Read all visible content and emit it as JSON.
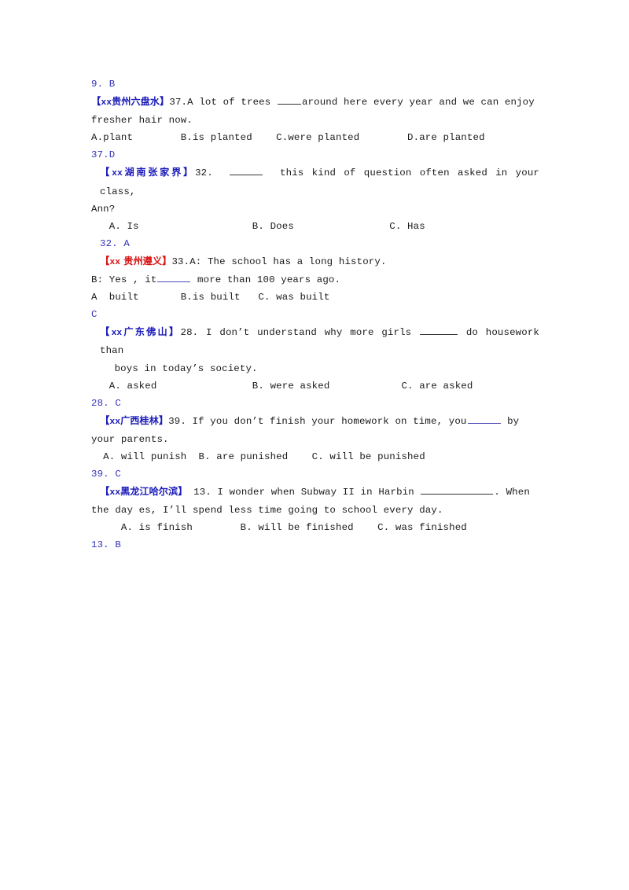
{
  "document": {
    "type": "english-grammar-exercise-answer-key",
    "colors": {
      "answer_blue": "#3333bb",
      "tag_blue": "#1a1aba",
      "tag_red": "#d81111",
      "body_text": "#1a1a1a",
      "page_background": "#ffffff"
    },
    "blocks": [
      {
        "id": "answer-9",
        "kind": "answer",
        "text": "9. B"
      },
      {
        "id": "q37",
        "kind": "question",
        "tag": {
          "bracket_open": "【",
          "xx": "xx",
          "region": "贵州六盘水",
          "bracket_close": "】",
          "color": "blue"
        },
        "number": "37.",
        "stem_part_1": "A lot of trees ",
        "stem_part_2": "around here every year and we can enjoy",
        "stem_line_2": "fresher hair now.",
        "options": "A.plant        B.is planted    C.were planted        D.are planted",
        "answer": "37.D"
      },
      {
        "id": "q32",
        "kind": "question",
        "tag": {
          "bracket_open": "【",
          "xx": "xx",
          "region": "湖南张家界",
          "bracket_close": "】",
          "color": "blue"
        },
        "number": "32.",
        "stem_part_1": "  ",
        "stem_part_2": "  this kind of question often asked in your class,",
        "stem_line_2": "Ann?",
        "options": "   A. Is                   B. Does                C. Has",
        "answer": "32. A"
      },
      {
        "id": "q33",
        "kind": "question",
        "tag": {
          "bracket_open": "【",
          "xx": "xx",
          "region": " 贵州遵义",
          "bracket_close": "】",
          "color": "red"
        },
        "number": "33.",
        "stem_part_1": "A: The school has a long history.",
        "stem_line_2_a": "B: Yes , it",
        "stem_line_2_b": " more than 100 years ago.",
        "options": "A  built       B.is built   C. was built",
        "answer": "C"
      },
      {
        "id": "q28",
        "kind": "question",
        "tag": {
          "bracket_open": "【",
          "xx": "xx",
          "region": "广东佛山",
          "bracket_close": "】",
          "color": "blue"
        },
        "number": "28.",
        "stem_part_1": " I don’t understand why more girls ",
        "stem_part_2": " do housework than",
        "stem_line_2": " boys in today’s society.",
        "options": "   A. asked                B. were asked            C. are asked",
        "answer": "28. C"
      },
      {
        "id": "q39",
        "kind": "question",
        "tag": {
          "bracket_open": "【",
          "xx": "xx",
          "region": "广西桂林",
          "bracket_close": "】",
          "color": "blue"
        },
        "number": "39.",
        "stem_part_1": " If you don’t finish your homework on time, you",
        "stem_part_2": " by",
        "stem_line_2": "your parents.",
        "options": "  A. will punish  B. are punished    C. will be punished",
        "answer": "39. C"
      },
      {
        "id": "q13",
        "kind": "question",
        "tag": {
          "bracket_open": "【",
          "xx": "xx",
          "region": "黑龙江哈尔滨",
          "bracket_close": "】",
          "color": "blue"
        },
        "number": " 13.",
        "stem_part_1": " I wonder when Subway II in Harbin ",
        "stem_part_2": ". When",
        "stem_line_2": "the day es, I’ll spend less time going to school every day.",
        "options": "     A. is finish        B. will be finished    C. was finished",
        "answer": "13. B"
      }
    ]
  }
}
